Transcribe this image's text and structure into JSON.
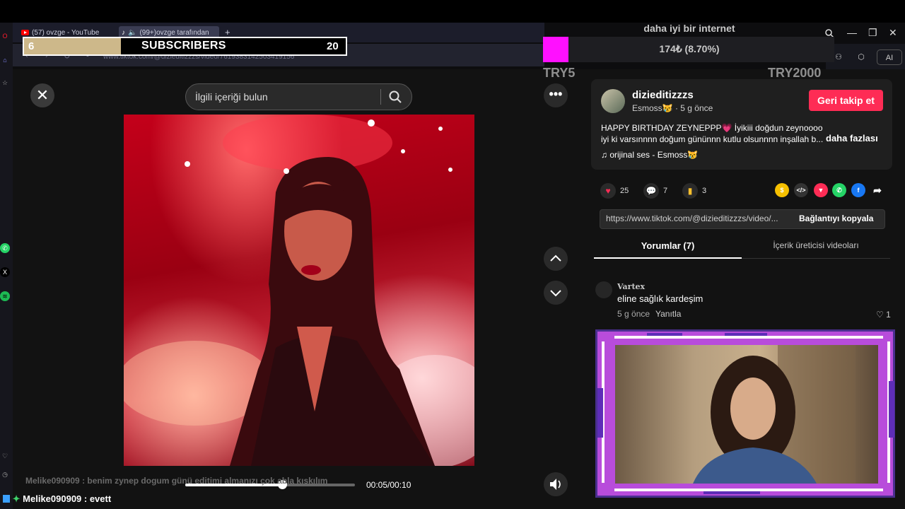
{
  "browser": {
    "tabs": [
      {
        "label": "(57) ovzge - YouTube"
      },
      {
        "label": "(99+)ovzge tarafından"
      }
    ],
    "new_tab": "+",
    "url": "www.tiktok.com/@dizieditizzzs/video/7619383142503419156",
    "ai_label": "AI"
  },
  "overlay": {
    "subscribers": {
      "label": "SUBSCRIBERS",
      "current": "6",
      "goal": "20",
      "progress": 0.3
    },
    "internet_goal": {
      "title": "daha iyi bir internet",
      "amount": "174₺ (8.70%)",
      "left_label": "TRY5",
      "right_label": "TRY2000",
      "progress": 0.087,
      "fill_color": "#ff10ff"
    },
    "chat": {
      "faded_line": "Melike090909 : benim zynep dogum günü editimi almanızı çok abla kıskılım",
      "line": "Melike090909 : evett"
    }
  },
  "video": {
    "search_placeholder": "İlgili içeriği bulun",
    "time": "00:05/00:10",
    "progress": 0.57,
    "close_label": "✕",
    "more_label": "•••"
  },
  "post": {
    "author": "dizieditizzzs",
    "subtitle": "Esmoss😿 · 5 g önce",
    "follow_label": "Geri takip et",
    "description_line1": "HAPPY BIRTHDAY ZEYNEPPP💗 İyikiii doğdun zeynoooo",
    "description_line2": "iyi ki varsınnnn doğum gününnn kutlu olsunnnn inşallah b...",
    "more_label": "daha fazlası",
    "sound": "♫  orijinal ses - Esmoss😿",
    "likes": "25",
    "comments": "7",
    "saves": "3",
    "link": "https://www.tiktok.com/@dizieditizzzs/video/...",
    "copy_label": "Bağlantıyı kopyala",
    "accent": "#fe2c55"
  },
  "tabs": {
    "comments": "Yorumlar (7)",
    "creator_videos": "İçerik üreticisi videoları"
  },
  "comment": {
    "user": "Vartex",
    "text": "eline sağlık kardeşim",
    "time": "5 g önce",
    "reply": "Yanıtla",
    "likes": "♡ 1"
  }
}
